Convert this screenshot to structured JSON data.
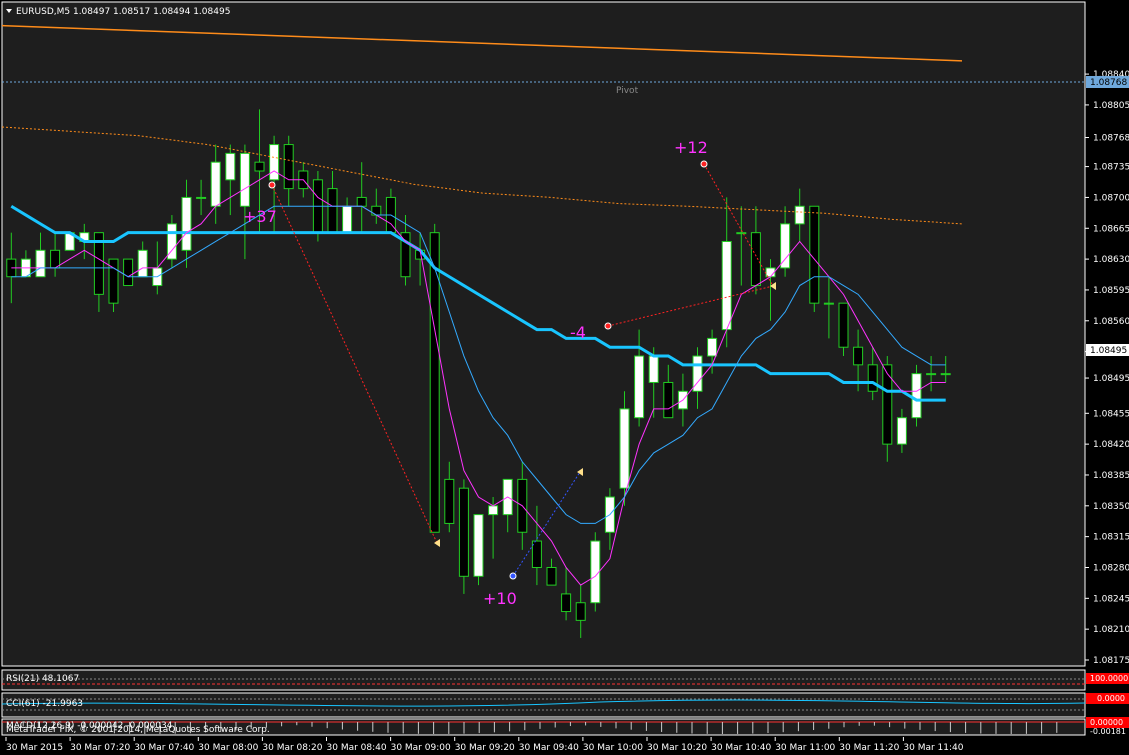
{
  "header": {
    "symbol_line": "EURUSD,M5  1.08497 1.08517 1.08494 1.08495"
  },
  "colors": {
    "background": "#000000",
    "chart_bg": "#1e1e1e",
    "frame": "#ffffff",
    "bull_body": "#ffffff",
    "bear_body": "#000000",
    "wick": "#22cc22",
    "ma_slow": "#19c5ff",
    "ma_fast": "#ff33ff",
    "ma_mid": "#33aaff",
    "top_line": "#ff8c1a",
    "dotted_line": "#ff8c1a",
    "trade_line": "#ff2222",
    "trade_label": "#ff33ff",
    "pivot_line": "#6fa8dc",
    "price_box": "#ffffff"
  },
  "pivot": {
    "label": "Pivot",
    "price": "1.08768"
  },
  "current_price": "1.08495",
  "trade_labels": [
    "+37",
    "+12",
    "-4",
    "+10"
  ],
  "indicators": {
    "rsi": "RSI(21) 48.1067",
    "cci": "CCI(61) -21.9963",
    "macd": "MACD(12,26,9) -0.000042 -0.000034",
    "rsi_value_box": "100.0000",
    "cci_value_box": "0.0000",
    "macd_value_box": "0.00000",
    "macd_scale": "-0.00181"
  },
  "footer": {
    "copyright": "MetaTrader FIX, © 2001-2014, MetaQuotes Software Corp."
  },
  "chart_data": {
    "type": "candlestick",
    "symbol": "EURUSD",
    "timeframe": "M5",
    "ylim": [
      1.08175,
      1.08915
    ],
    "y_ticks": [
      "1.08840",
      "1.08805",
      "1.08768",
      "1.08735",
      "1.08700",
      "1.08665",
      "1.08630",
      "1.08595",
      "1.08560",
      "1.08525",
      "1.08495",
      "1.08455",
      "1.08420",
      "1.08385",
      "1.08350",
      "1.08315",
      "1.08280",
      "1.08245",
      "1.08210",
      "1.08175"
    ],
    "x_ticks": [
      "30 Mar 2015",
      "30 Mar 07:20",
      "30 Mar 07:40",
      "30 Mar 08:00",
      "30 Mar 08:20",
      "30 Mar 08:40",
      "30 Mar 09:00",
      "30 Mar 09:20",
      "30 Mar 09:40",
      "30 Mar 10:00",
      "30 Mar 10:20",
      "30 Mar 10:40",
      "30 Mar 11:00",
      "30 Mar 11:20",
      "30 Mar 11:40"
    ],
    "candles": [
      {
        "o": 1.0863,
        "h": 1.0866,
        "l": 1.0858,
        "c": 1.0861
      },
      {
        "o": 1.0861,
        "h": 1.0864,
        "l": 1.0861,
        "c": 1.0863
      },
      {
        "o": 1.0861,
        "h": 1.0866,
        "l": 1.0861,
        "c": 1.0864
      },
      {
        "o": 1.0864,
        "h": 1.0866,
        "l": 1.0861,
        "c": 1.0862
      },
      {
        "o": 1.0864,
        "h": 1.0866,
        "l": 1.0864,
        "c": 1.0866
      },
      {
        "o": 1.0865,
        "h": 1.0867,
        "l": 1.0863,
        "c": 1.0866
      },
      {
        "o": 1.0866,
        "h": 1.0866,
        "l": 1.0857,
        "c": 1.0859
      },
      {
        "o": 1.0863,
        "h": 1.0863,
        "l": 1.0857,
        "c": 1.0858
      },
      {
        "o": 1.0863,
        "h": 1.0863,
        "l": 1.086,
        "c": 1.086
      },
      {
        "o": 1.0861,
        "h": 1.0865,
        "l": 1.0861,
        "c": 1.0864
      },
      {
        "o": 1.086,
        "h": 1.0865,
        "l": 1.0859,
        "c": 1.0862
      },
      {
        "o": 1.0863,
        "h": 1.0868,
        "l": 1.0862,
        "c": 1.0867
      },
      {
        "o": 1.0864,
        "h": 1.0872,
        "l": 1.0862,
        "c": 1.087
      },
      {
        "o": 1.087,
        "h": 1.0872,
        "l": 1.0868,
        "c": 1.087
      },
      {
        "o": 1.0869,
        "h": 1.0876,
        "l": 1.0867,
        "c": 1.0874
      },
      {
        "o": 1.0872,
        "h": 1.0876,
        "l": 1.0868,
        "c": 1.0875
      },
      {
        "o": 1.0869,
        "h": 1.0876,
        "l": 1.0863,
        "c": 1.0875
      },
      {
        "o": 1.0874,
        "h": 1.088,
        "l": 1.0866,
        "c": 1.0873
      },
      {
        "o": 1.0872,
        "h": 1.0877,
        "l": 1.0866,
        "c": 1.0876
      },
      {
        "o": 1.0876,
        "h": 1.0877,
        "l": 1.0869,
        "c": 1.0871
      },
      {
        "o": 1.0873,
        "h": 1.0874,
        "l": 1.087,
        "c": 1.0871
      },
      {
        "o": 1.0872,
        "h": 1.0873,
        "l": 1.0865,
        "c": 1.0866
      },
      {
        "o": 1.0871,
        "h": 1.0873,
        "l": 1.0866,
        "c": 1.0866
      },
      {
        "o": 1.0866,
        "h": 1.087,
        "l": 1.0866,
        "c": 1.0869
      },
      {
        "o": 1.087,
        "h": 1.0874,
        "l": 1.0866,
        "c": 1.0869
      },
      {
        "o": 1.0869,
        "h": 1.0871,
        "l": 1.0867,
        "c": 1.0868
      },
      {
        "o": 1.087,
        "h": 1.0871,
        "l": 1.0866,
        "c": 1.0866
      },
      {
        "o": 1.0866,
        "h": 1.0868,
        "l": 1.086,
        "c": 1.0861
      },
      {
        "o": 1.0864,
        "h": 1.0866,
        "l": 1.086,
        "c": 1.0863
      },
      {
        "o": 1.0866,
        "h": 1.0867,
        "l": 1.0832,
        "c": 1.0832
      },
      {
        "o": 1.0838,
        "h": 1.084,
        "l": 1.0832,
        "c": 1.0833
      },
      {
        "o": 1.0837,
        "h": 1.0838,
        "l": 1.0825,
        "c": 1.0827
      },
      {
        "o": 1.0827,
        "h": 1.0834,
        "l": 1.0826,
        "c": 1.0834
      },
      {
        "o": 1.0834,
        "h": 1.0836,
        "l": 1.0829,
        "c": 1.0835
      },
      {
        "o": 1.0834,
        "h": 1.0838,
        "l": 1.0832,
        "c": 1.0838
      },
      {
        "o": 1.0838,
        "h": 1.084,
        "l": 1.083,
        "c": 1.0832
      },
      {
        "o": 1.0831,
        "h": 1.0835,
        "l": 1.0826,
        "c": 1.0828
      },
      {
        "o": 1.0828,
        "h": 1.0829,
        "l": 1.0826,
        "c": 1.0826
      },
      {
        "o": 1.0825,
        "h": 1.0828,
        "l": 1.0822,
        "c": 1.0823
      },
      {
        "o": 1.0824,
        "h": 1.0826,
        "l": 1.082,
        "c": 1.0822
      },
      {
        "o": 1.0824,
        "h": 1.0832,
        "l": 1.0823,
        "c": 1.0831
      },
      {
        "o": 1.0832,
        "h": 1.0837,
        "l": 1.083,
        "c": 1.0836
      },
      {
        "o": 1.0837,
        "h": 1.0848,
        "l": 1.0835,
        "c": 1.0846
      },
      {
        "o": 1.0845,
        "h": 1.0855,
        "l": 1.0844,
        "c": 1.0852
      },
      {
        "o": 1.0849,
        "h": 1.0853,
        "l": 1.0845,
        "c": 1.0852
      },
      {
        "o": 1.0849,
        "h": 1.0851,
        "l": 1.0845,
        "c": 1.0845
      },
      {
        "o": 1.0846,
        "h": 1.085,
        "l": 1.0844,
        "c": 1.0848
      },
      {
        "o": 1.0848,
        "h": 1.0853,
        "l": 1.0846,
        "c": 1.0852
      },
      {
        "o": 1.0852,
        "h": 1.0855,
        "l": 1.085,
        "c": 1.0854
      },
      {
        "o": 1.0855,
        "h": 1.087,
        "l": 1.0853,
        "c": 1.0865
      },
      {
        "o": 1.0866,
        "h": 1.0869,
        "l": 1.086,
        "c": 1.0866
      },
      {
        "o": 1.0866,
        "h": 1.0869,
        "l": 1.0859,
        "c": 1.086
      },
      {
        "o": 1.0861,
        "h": 1.0863,
        "l": 1.0856,
        "c": 1.0862
      },
      {
        "o": 1.0862,
        "h": 1.0869,
        "l": 1.0861,
        "c": 1.0867
      },
      {
        "o": 1.0867,
        "h": 1.0871,
        "l": 1.0865,
        "c": 1.0869
      },
      {
        "o": 1.0869,
        "h": 1.0869,
        "l": 1.0857,
        "c": 1.0858
      },
      {
        "o": 1.0858,
        "h": 1.0861,
        "l": 1.0854,
        "c": 1.0858
      },
      {
        "o": 1.0858,
        "h": 1.0858,
        "l": 1.0852,
        "c": 1.0853
      },
      {
        "o": 1.0853,
        "h": 1.0855,
        "l": 1.0848,
        "c": 1.0851
      },
      {
        "o": 1.0851,
        "h": 1.0853,
        "l": 1.0847,
        "c": 1.0848
      },
      {
        "o": 1.0851,
        "h": 1.0852,
        "l": 1.084,
        "c": 1.0842
      },
      {
        "o": 1.0842,
        "h": 1.0846,
        "l": 1.0841,
        "c": 1.0845
      },
      {
        "o": 1.0845,
        "h": 1.0851,
        "l": 1.0844,
        "c": 1.085
      },
      {
        "o": 1.085,
        "h": 1.0852,
        "l": 1.0848,
        "c": 1.085
      },
      {
        "o": 1.085,
        "h": 1.0852,
        "l": 1.0849,
        "c": 1.085
      }
    ],
    "series": [
      {
        "role": "ma_slow",
        "values": [
          1.0869,
          1.0868,
          1.0867,
          1.0866,
          1.0866,
          1.0865,
          1.0865,
          1.0865,
          1.0866,
          1.0866,
          1.0866,
          1.0866,
          1.0866,
          1.0866,
          1.0866,
          1.0866,
          1.0866,
          1.0866,
          1.0866,
          1.0866,
          1.0866,
          1.0866,
          1.0866,
          1.0866,
          1.0866,
          1.0866,
          1.0866,
          1.0865,
          1.0864,
          1.0862,
          1.0861,
          1.086,
          1.0859,
          1.0858,
          1.0857,
          1.0856,
          1.0855,
          1.0855,
          1.0854,
          1.0854,
          1.0854,
          1.0853,
          1.0853,
          1.0853,
          1.0852,
          1.0852,
          1.0851,
          1.0851,
          1.0851,
          1.0851,
          1.0851,
          1.0851,
          1.085,
          1.085,
          1.085,
          1.085,
          1.085,
          1.0849,
          1.0849,
          1.0849,
          1.0848,
          1.0848,
          1.0847,
          1.0847,
          1.0847
        ]
      },
      {
        "role": "ma_fast",
        "values": [
          1.0862,
          1.0862,
          1.0862,
          1.0862,
          1.0863,
          1.0864,
          1.0863,
          1.0862,
          1.0861,
          1.0862,
          1.0862,
          1.0864,
          1.0866,
          1.0867,
          1.0869,
          1.087,
          1.0871,
          1.0872,
          1.0873,
          1.0872,
          1.0872,
          1.087,
          1.0869,
          1.0869,
          1.0869,
          1.0868,
          1.0867,
          1.0865,
          1.0864,
          1.0855,
          1.0846,
          1.0839,
          1.0836,
          1.0835,
          1.0836,
          1.0835,
          1.0833,
          1.0831,
          1.0828,
          1.0826,
          1.0827,
          1.0829,
          1.0836,
          1.0842,
          1.0846,
          1.0846,
          1.0847,
          1.0849,
          1.0851,
          1.0855,
          1.0859,
          1.086,
          1.0861,
          1.0863,
          1.0865,
          1.0863,
          1.0861,
          1.0859,
          1.0856,
          1.0853,
          1.085,
          1.0848,
          1.0848,
          1.0849,
          1.0849
        ]
      },
      {
        "role": "ma_mid",
        "values": [
          1.0861,
          1.0861,
          1.0862,
          1.0862,
          1.0862,
          1.0862,
          1.0862,
          1.0862,
          1.0861,
          1.0861,
          1.0861,
          1.0862,
          1.0863,
          1.0864,
          1.0865,
          1.0866,
          1.0867,
          1.0868,
          1.0869,
          1.0869,
          1.0869,
          1.0869,
          1.0869,
          1.0869,
          1.0869,
          1.0868,
          1.0868,
          1.0867,
          1.0866,
          1.0862,
          1.0857,
          1.0852,
          1.0848,
          1.0845,
          1.0843,
          1.084,
          1.0838,
          1.0836,
          1.0834,
          1.0833,
          1.0833,
          1.0834,
          1.0836,
          1.0839,
          1.0841,
          1.0842,
          1.0843,
          1.0845,
          1.0846,
          1.0849,
          1.0852,
          1.0854,
          1.0855,
          1.0857,
          1.086,
          1.0861,
          1.0861,
          1.086,
          1.0859,
          1.0857,
          1.0855,
          1.0853,
          1.0852,
          1.0851,
          1.0851
        ]
      }
    ],
    "top_line": [
      1.08895,
      1.08855
    ],
    "dotted_line_points": [
      1.0878,
      1.08775,
      1.0877,
      1.0876,
      1.08745,
      1.0873,
      1.08715,
      1.08705,
      1.087,
      1.08693,
      1.0869,
      1.08686,
      1.08682,
      1.08675,
      1.0867
    ]
  }
}
